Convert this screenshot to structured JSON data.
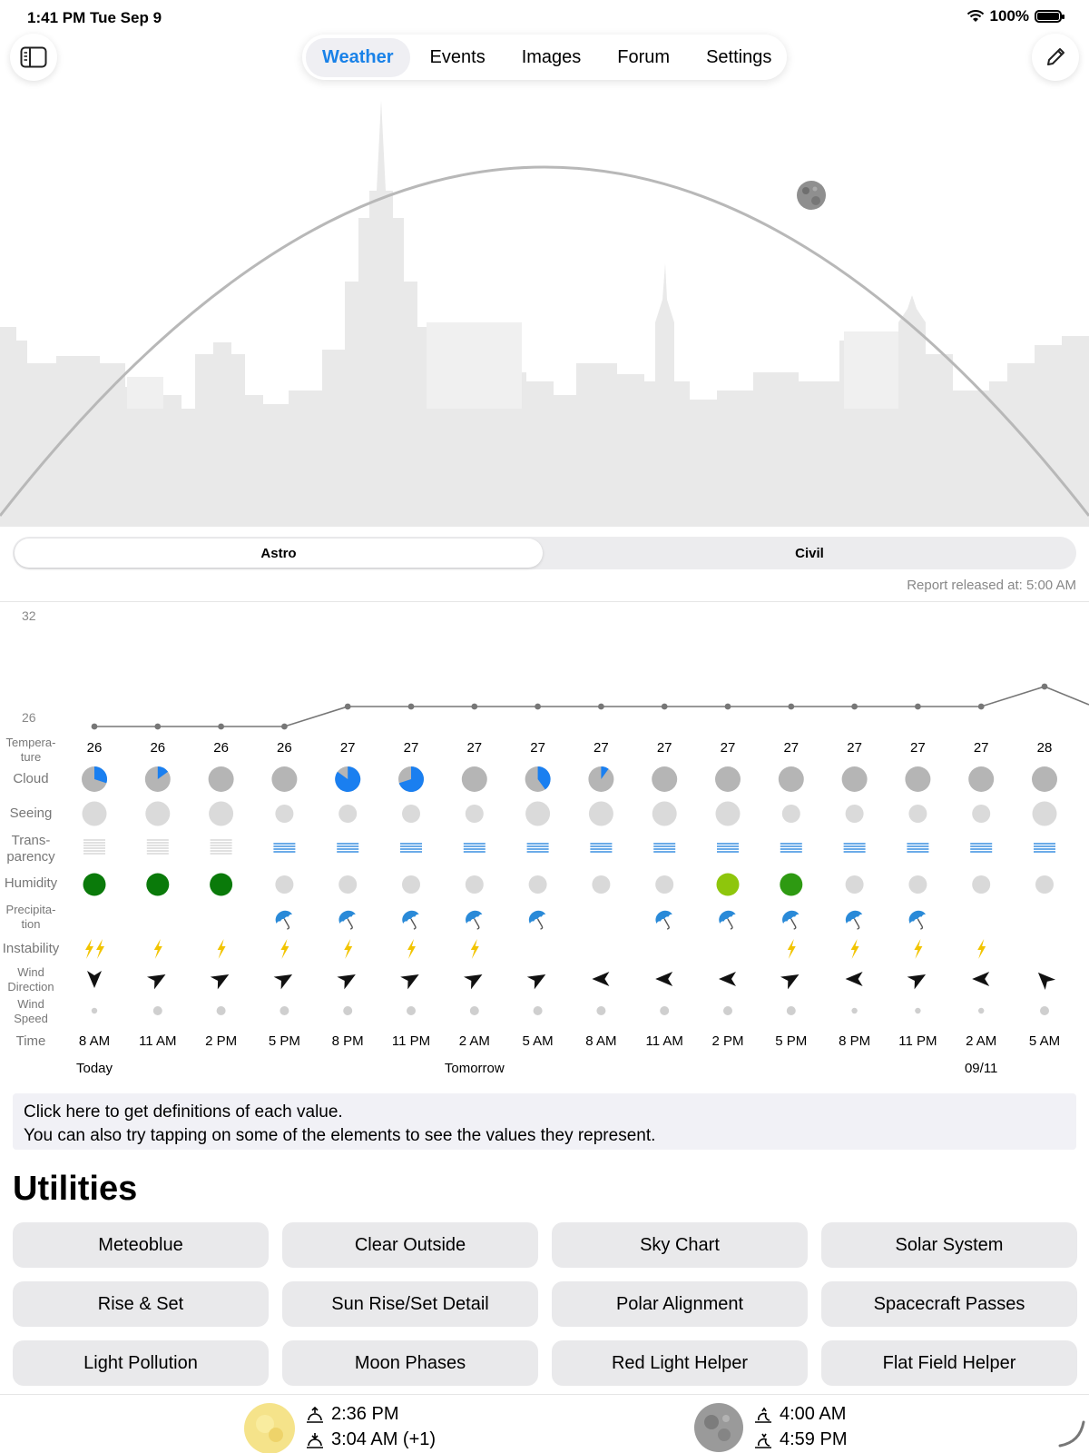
{
  "status": {
    "time": "1:41 PM",
    "date": "Tue Sep 9",
    "battery": "100%"
  },
  "tabs": [
    {
      "label": "Weather",
      "active": true
    },
    {
      "label": "Events"
    },
    {
      "label": "Images"
    },
    {
      "label": "Forum"
    },
    {
      "label": "Settings"
    }
  ],
  "mode": {
    "astro": "Astro",
    "civil": "Civil",
    "selected": "Astro"
  },
  "report": "Report released at: 5:00 AM",
  "forecast": {
    "y_labels": [
      "32",
      "26"
    ],
    "row_labels": {
      "temperature": "Tempera-\nture",
      "cloud": "Cloud",
      "seeing": "Seeing",
      "transparency": "Trans-\nparency",
      "humidity": "Humidity",
      "precipitation": "Precipita-\ntion",
      "instability": "Instability",
      "wind_direction": "Wind\nDirection",
      "wind_speed": "Wind\nSpeed",
      "time": "Time"
    },
    "temperatures": [
      26,
      26,
      26,
      26,
      27,
      27,
      27,
      27,
      27,
      27,
      27,
      27,
      27,
      27,
      27,
      28
    ],
    "times": [
      "8 AM",
      "11 AM",
      "2 PM",
      "5 PM",
      "8 PM",
      "11 PM",
      "2 AM",
      "5 AM",
      "8 AM",
      "11 AM",
      "2 PM",
      "5 PM",
      "8 PM",
      "11 PM",
      "2 AM",
      "5 AM"
    ],
    "cloud_clear_fraction": [
      0.3,
      0.15,
      0,
      0,
      0.85,
      0.7,
      0,
      0.4,
      0.1,
      0,
      0,
      0,
      0,
      0,
      0,
      0
    ],
    "seeing_level": [
      3,
      3,
      3,
      2,
      2,
      2,
      2,
      3,
      3,
      3,
      3,
      2,
      2,
      2,
      2,
      3
    ],
    "transparency_good": [
      false,
      false,
      false,
      true,
      true,
      true,
      true,
      true,
      true,
      true,
      true,
      true,
      true,
      true,
      true,
      true
    ],
    "humidity": [
      "dark-green",
      "dark-green",
      "dark-green",
      "grey",
      "grey",
      "grey",
      "grey",
      "grey",
      "grey",
      "grey",
      "lime",
      "green",
      "grey",
      "grey",
      "grey",
      "grey"
    ],
    "precipitation": [
      false,
      false,
      false,
      true,
      true,
      true,
      true,
      true,
      false,
      true,
      true,
      true,
      true,
      true,
      false,
      false
    ],
    "instability": [
      2,
      1,
      1,
      1,
      1,
      1,
      1,
      0,
      0,
      0,
      0,
      1,
      1,
      1,
      1,
      0
    ],
    "wind_direction_deg": [
      180,
      60,
      60,
      60,
      60,
      60,
      60,
      60,
      270,
      270,
      270,
      60,
      270,
      60,
      270,
      315
    ],
    "wind_speed_level": [
      1,
      2,
      2,
      2,
      2,
      2,
      2,
      2,
      2,
      2,
      2,
      2,
      1,
      1,
      1,
      2
    ],
    "days": [
      {
        "label": "Today",
        "index": 0
      },
      {
        "label": "Tomorrow",
        "index": 6
      },
      {
        "label": "09/11",
        "index": 14
      }
    ],
    "colors": {
      "cloud_clear": "#1a7ff0",
      "cloud": "#b5b5b5",
      "dark-green": "#0a7a0a",
      "green": "#2e9a12",
      "lime": "#8ec60c",
      "grey": "#d9d9d9",
      "bolt": "#f2c400",
      "umbrella": "#2a8ad8"
    }
  },
  "info": {
    "line1": "Click here to get definitions of each value.",
    "line2": "You can also try tapping on some of the elements to see the values they represent."
  },
  "utilities": {
    "title": "Utilities",
    "buttons": [
      "Meteoblue",
      "Clear Outside",
      "Sky Chart",
      "Solar System",
      "Rise & Set",
      "Sun Rise/Set Detail",
      "Polar Alignment",
      "Spacecraft Passes",
      "Light Pollution",
      "Moon Phases",
      "Red Light Helper",
      "Flat Field Helper"
    ]
  },
  "sun": {
    "rise": "2:36 PM",
    "set": "3:04 AM (+1)"
  },
  "moon": {
    "rise": "4:00 AM",
    "set": "4:59 PM"
  }
}
